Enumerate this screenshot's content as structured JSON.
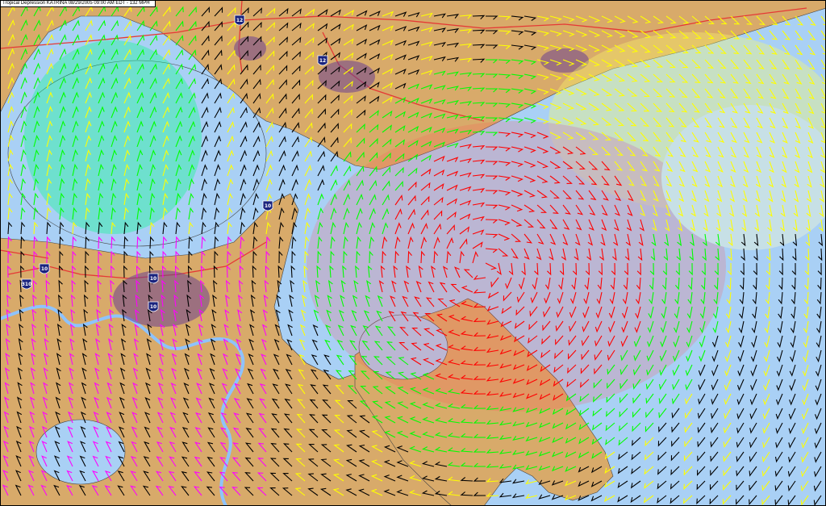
{
  "header": {
    "title": "Tropical Depression KATRINA 08/29/2005 09:00 AM EDT - 132 MPH"
  },
  "colors": {
    "water": "#a9d0f5",
    "land": "#d8aa6a",
    "wind_low": "#000000",
    "wind_moderate": "#ff00ff",
    "wind_strong": "#00ff00",
    "wind_high": "#ffff00",
    "wind_extreme": "#ff0000",
    "interstate_shield": "#1a237e",
    "river": "#8ec3ff",
    "road": "#e53935",
    "urban": "#6b3f8f"
  },
  "map": {
    "feature": "wind-vector-field",
    "highway_shields": [
      {
        "route": "12",
        "name": "shield-i12-north"
      },
      {
        "route": "12",
        "name": "shield-i12-east"
      },
      {
        "route": "10",
        "name": "shield-i10-northeast"
      },
      {
        "route": "10",
        "name": "shield-i10-west"
      },
      {
        "route": "10",
        "name": "shield-i10-central"
      },
      {
        "route": "10",
        "name": "shield-i10-south"
      },
      {
        "route": "310",
        "name": "shield-310"
      }
    ]
  }
}
